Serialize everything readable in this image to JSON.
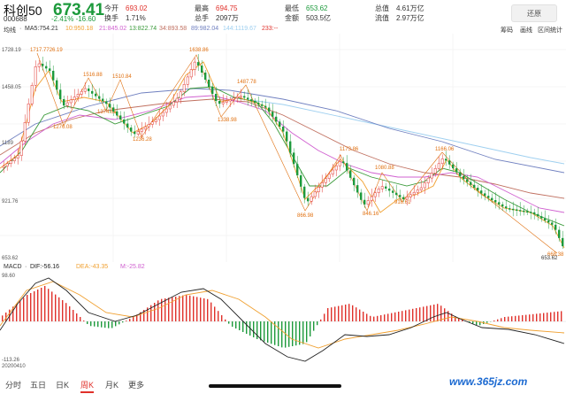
{
  "header": {
    "name": "科创50",
    "code": "000688",
    "price": "673.41",
    "change": "-2.41%  -16.60",
    "stats": [
      {
        "label": "今开",
        "value": "693.02",
        "color": "red"
      },
      {
        "label": "最高",
        "value": "694.75",
        "color": "red"
      },
      {
        "label": "最低",
        "value": "653.62",
        "color": "grn"
      },
      {
        "label": "总值",
        "value": "4.61万亿",
        "color": ""
      },
      {
        "label": "换手",
        "value": "1.71%",
        "color": ""
      },
      {
        "label": "总手",
        "value": "2097万",
        "color": ""
      },
      {
        "label": "金额",
        "value": "503.5亿",
        "color": ""
      },
      {
        "label": "流值",
        "value": "2.97万亿",
        "color": ""
      }
    ],
    "restore_label": "还原"
  },
  "ma_bar": {
    "mode": "均线",
    "ma5": "MA5:754.21",
    "ma10": "10:950.18",
    "ma21": "21:845.02",
    "ma13": "13:822.74",
    "ma34": "34:893.58",
    "ma89": "89:982.04",
    "ma144": "144:1119.67",
    "ma233": "233:--"
  },
  "toolbar": {
    "chip": "筹码",
    "draw": "画线",
    "stats": "区间统计"
  },
  "price_axis": {
    "top": "1728.19",
    "mid1": "1458.05",
    "mid2": "1189",
    "mid3": "921.76",
    "bottom": "653.62"
  },
  "annotations": {
    "a1": "1717.7726.19",
    "a2": "1516.88",
    "a3": "1510.84",
    "a4": "1374.68",
    "a5": "1276.08",
    "a6": "1236.28",
    "a7": "1638.86",
    "a8": "1487.78",
    "a9": "1338.98",
    "a10": "866.98",
    "a11": "1173.86",
    "a12": "1080.88",
    "a13": "846.16",
    "a14": "916.61",
    "a15": "1166.06",
    "a16": "668.38",
    "a17": "653.62"
  },
  "macd_bar": {
    "label": "MACD",
    "dif": "DIF:-56.16",
    "dea": "DEA:-43.35",
    "m": "M:-25.82"
  },
  "macd_axis": {
    "top": "98.60",
    "bottom": "-113.26",
    "start_date": "20200410"
  },
  "colors": {
    "up": "#e0302a",
    "down": "#1d9a3c",
    "ma5": "#f0a030",
    "ma10": "#d060d0",
    "ma21": "#3a9a3a",
    "ma34": "#c07060",
    "ma89": "#7080c0",
    "ma144": "#9fd0f0",
    "dif": "#222222",
    "dea": "#f0a030"
  },
  "tabs": [
    "分时",
    "五日",
    "日K",
    "周K",
    "月K",
    "更多"
  ],
  "active_tab": "周K",
  "watermark": "www.365jz.com"
}
